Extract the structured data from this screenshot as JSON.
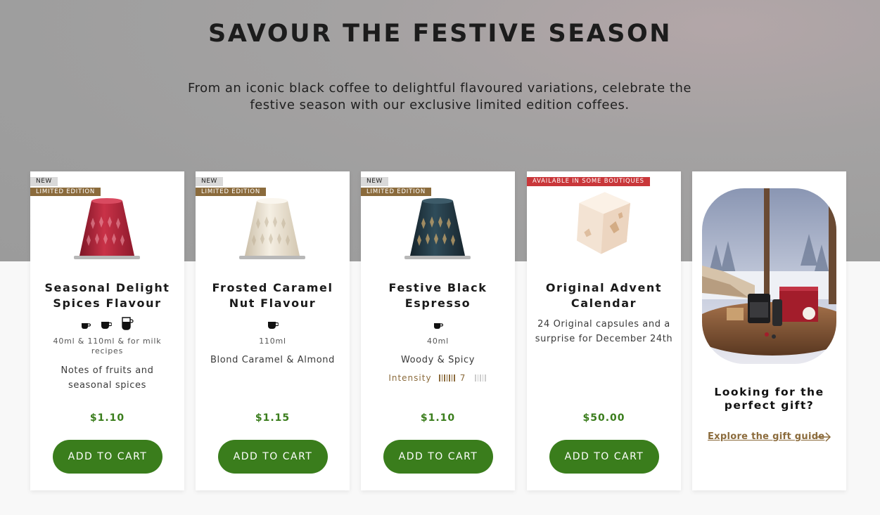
{
  "hero": {
    "title": "SAVOUR THE FESTIVE SEASON",
    "subtitle": "From an iconic black coffee to delightful flavoured variations, celebrate the festive season with our exclusive limited edition coffees."
  },
  "colors": {
    "accent_green": "#3a7d1c",
    "brand_gold": "#8b6b3c",
    "badge_red": "#c9373a"
  },
  "products": [
    {
      "badge_new": "NEW",
      "badge_limited": "LIMITED EDITION",
      "name_line1": "Seasonal Delight",
      "name_line2": "Spices Flavour",
      "size": "40ml & 110ml & for milk recipes",
      "description": "Notes of fruits and seasonal spices",
      "price": "$1.10",
      "cta": "ADD TO CART",
      "capsule_color": "#b3233a"
    },
    {
      "badge_new": "NEW",
      "badge_limited": "LIMITED EDITION",
      "name_line1": "Frosted Caramel",
      "name_line2": "Nut Flavour",
      "size": "110ml",
      "description": "Blond Caramel & Almond",
      "price": "$1.15",
      "cta": "ADD TO CART",
      "capsule_color": "#e7ddca"
    },
    {
      "badge_new": "NEW",
      "badge_limited": "LIMITED EDITION",
      "name_line1": "Festive Black",
      "name_line2": "Espresso",
      "size": "40ml",
      "description": "Woody & Spicy",
      "intensity_label": "Intensity",
      "intensity_value": "7",
      "price": "$1.10",
      "cta": "ADD TO CART",
      "capsule_color": "#233b47"
    },
    {
      "badge_boutique": "AVAILABLE IN SOME BOUTIQUES",
      "name_line1": "Original Advent",
      "name_line2": "Calendar",
      "description": "24 Original capsules and a surprise for December 24th",
      "price": "$50.00",
      "cta": "ADD TO CART"
    }
  ],
  "gift": {
    "title_line1": "Looking for the",
    "title_line2": "perfect gift?",
    "link": "Explore the gift guide"
  }
}
